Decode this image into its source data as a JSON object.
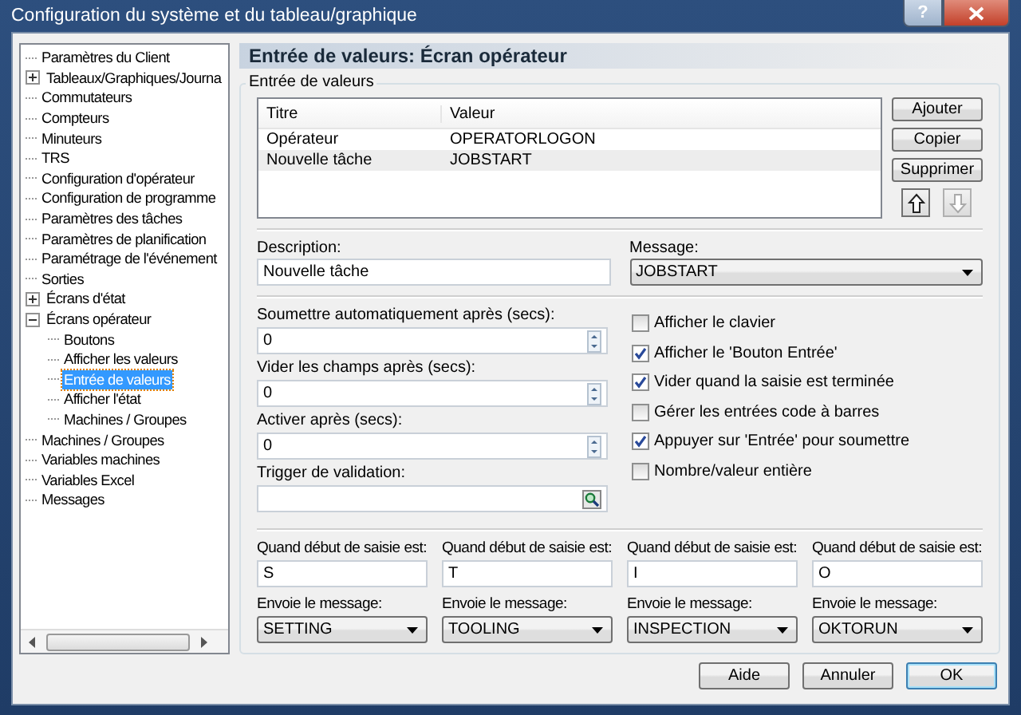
{
  "window": {
    "title": "Configuration du système et du tableau/graphique",
    "help_button": "?"
  },
  "sidebar": {
    "items": [
      {
        "label": "Paramètres du Client",
        "selected": false
      },
      {
        "label": "Tableaux/Graphiques/Journa",
        "selected": false,
        "expanded": false
      },
      {
        "label": "Commutateurs",
        "selected": false
      },
      {
        "label": "Compteurs",
        "selected": false
      },
      {
        "label": "Minuteurs",
        "selected": false
      },
      {
        "label": "TRS",
        "selected": false
      },
      {
        "label": "Configuration d'opérateur",
        "selected": false
      },
      {
        "label": "Configuration de programme",
        "selected": false
      },
      {
        "label": "Paramètres des tâches",
        "selected": false
      },
      {
        "label": "Paramètres de planification",
        "selected": false
      },
      {
        "label": "Paramétrage de l'événement",
        "selected": false
      },
      {
        "label": "Sorties",
        "selected": false
      },
      {
        "label": "Écrans d'état",
        "selected": false,
        "expanded": false
      },
      {
        "label": "Écrans opérateur",
        "selected": false,
        "expanded": true,
        "children": [
          {
            "label": "Boutons",
            "selected": false
          },
          {
            "label": "Afficher les valeurs",
            "selected": false
          },
          {
            "label": "Entrée de valeurs",
            "selected": true
          },
          {
            "label": "Afficher l'état",
            "selected": false
          },
          {
            "label": "Machines / Groupes",
            "selected": false
          }
        ]
      },
      {
        "label": "Machines / Groupes",
        "selected": false
      },
      {
        "label": "Variables machines",
        "selected": false
      },
      {
        "label": "Variables Excel",
        "selected": false
      },
      {
        "label": "Messages",
        "selected": false
      }
    ]
  },
  "panel": {
    "title": "Entrée de valeurs: Écran opérateur",
    "group_title": "Entrée de valeurs",
    "table": {
      "columns": [
        "Titre",
        "Valeur"
      ],
      "rows": [
        {
          "cells": [
            "Opérateur",
            "OPERATORLOGON"
          ],
          "selected": false
        },
        {
          "cells": [
            "Nouvelle tâche",
            "JOBSTART"
          ],
          "selected": true
        }
      ]
    },
    "table_buttons": [
      "Ajouter",
      "Copier",
      "Supprimer"
    ],
    "arrow_buttons": [
      {
        "kind": "up",
        "disabled": false
      },
      {
        "kind": "down",
        "disabled": true
      }
    ],
    "description": {
      "label": "Description:",
      "value": "Nouvelle tâche"
    },
    "message": {
      "label": "Message:",
      "value": "JOBSTART"
    },
    "fields": [
      {
        "kind": "spin",
        "label": "Soumettre automatiquement après (secs):",
        "value": "0"
      },
      {
        "kind": "spin",
        "label": "Vider les champs après (secs):",
        "value": "0"
      },
      {
        "kind": "spin",
        "label": "Activer après (secs):",
        "value": "0"
      },
      {
        "kind": "search",
        "label": "Trigger de validation:"
      }
    ],
    "checkboxes": [
      {
        "label": "Afficher le clavier",
        "checked": false
      },
      {
        "label": "Afficher le 'Bouton Entrée'",
        "checked": true
      },
      {
        "label": "Vider quand la saisie est terminée",
        "checked": true
      },
      {
        "label": "Gérer les entrées code à barres",
        "checked": false
      },
      {
        "label": "Appuyer sur 'Entrée' pour soumettre",
        "checked": true
      },
      {
        "label": "Nombre/valeur entière",
        "checked": false
      }
    ],
    "triggers": [
      {
        "start_label": "Quand début de saisie est:",
        "start_value": "S",
        "message_label": "Envoie le message:",
        "message_value": "SETTING"
      },
      {
        "start_label": "Quand début de saisie est:",
        "start_value": "T",
        "message_label": "Envoie le message:",
        "message_value": "TOOLING"
      },
      {
        "start_label": "Quand début de saisie est:",
        "start_value": "I",
        "message_label": "Envoie le message:",
        "message_value": "INSPECTION"
      },
      {
        "start_label": "Quand début de saisie est:",
        "start_value": "O",
        "message_label": "Envoie le message:",
        "message_value": "OKTORUN"
      }
    ]
  },
  "footer_buttons": [
    {
      "label": "Aide",
      "default": false
    },
    {
      "label": "Annuler",
      "default": false
    },
    {
      "label": "OK",
      "default": true
    }
  ]
}
